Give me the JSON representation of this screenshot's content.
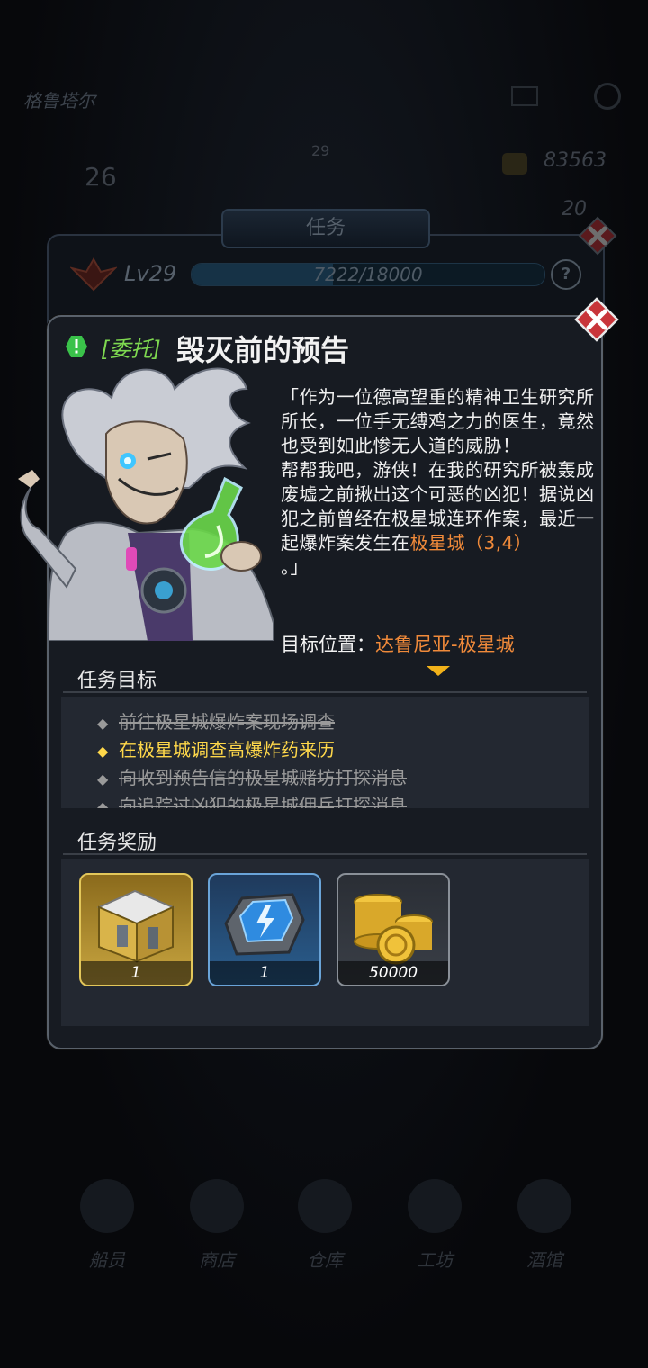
{
  "background": {
    "player_name": "格鲁塔尔",
    "left_counter": "26",
    "level_badge": "29",
    "gold_amount": "83563",
    "gem_amount": "20",
    "nav": [
      {
        "label": "船员"
      },
      {
        "label": "商店"
      },
      {
        "label": "仓库"
      },
      {
        "label": "工坊"
      },
      {
        "label": "酒馆"
      }
    ]
  },
  "quest_window": {
    "title": "任务",
    "level_label": "Lv29",
    "exp_text": "7222/18000",
    "exp_progress": 0.4012,
    "help_label": "?"
  },
  "quest_detail": {
    "type_tag": "[委托]",
    "title": "毁灭前的预告",
    "story_part1": "「作为一位德高望重的精神卫生研究所所长，一位手无缚鸡之力的医生，竟然也受到如此惨无人道的威胁！",
    "story_part2": "帮帮我吧，游侠！在我的研究所被轰成废墟之前揪出这个可恶的凶犯！据说凶犯之前曾经在极星城连环作案，最近一起爆炸案发生在",
    "story_highlight": "极星城（3,4）",
    "story_end": "。」",
    "target_label": "目标位置：",
    "target_value": "达鲁尼亚-极星城",
    "objectives_title": "任务目标",
    "objectives": [
      {
        "text": "前往极星城爆炸案现场调查",
        "status": "done"
      },
      {
        "text": "在极星城调查高爆炸药来历",
        "status": "current"
      },
      {
        "text": "向收到预告信的极星城赌坊打探消息",
        "status": "done"
      },
      {
        "text": "向追踪过凶犯的极星城佣兵打探消息",
        "status": "done"
      }
    ],
    "rewards_title": "任务奖励",
    "rewards": [
      {
        "name": "supply-crate",
        "qty": "1"
      },
      {
        "name": "energy-core",
        "qty": "1"
      },
      {
        "name": "gold-coins",
        "qty": "50000"
      }
    ]
  },
  "colors": {
    "highlight_orange": "#f08a3a",
    "objective_current": "#ffd84a",
    "type_tag_green": "#7ed850",
    "close_red": "#c8353a"
  }
}
